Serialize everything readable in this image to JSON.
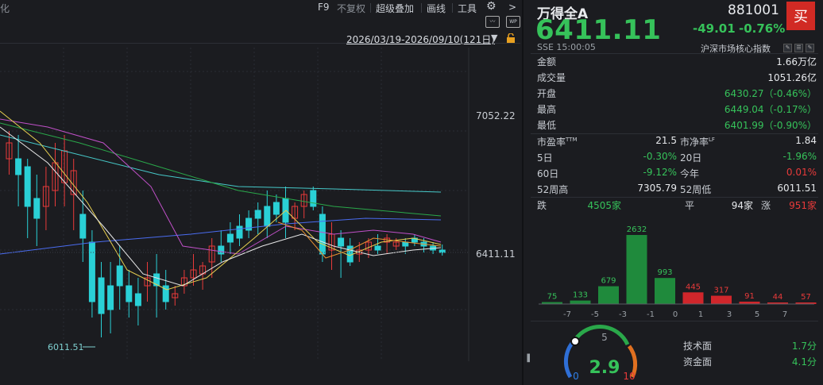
{
  "toolbar": {
    "items": [
      "F9",
      "不复权",
      "超级叠加",
      "画线",
      "工具"
    ],
    "left_cut": "化",
    "chevron": ">"
  },
  "range_label": "2026/03/19-2026/09/10(121日)",
  "chart_labels": {
    "y_top": "7052.22",
    "y_current": "6411.11",
    "low_mark": "6011.51"
  },
  "header": {
    "name": "万得全A",
    "code": "881001",
    "buy_label": "买",
    "price": "6411.11",
    "change": "-49.01",
    "change_pct": "-0.76%",
    "exchange_time": "SSE  15:00:05",
    "index_group": "沪深市场核心指数"
  },
  "stats": {
    "amount_label": "金额",
    "amount": "1.66万亿",
    "volume_label": "成交量",
    "volume": "1051.26亿",
    "open_label": "开盘",
    "open": "6430.27（-0.46%）",
    "high_label": "最高",
    "high": "6449.04（-0.17%）",
    "low_label": "最低",
    "low": "6401.99（-0.90%）"
  },
  "metrics": {
    "pe_label": "市盈率",
    "pe_sup": "TTM",
    "pe": "21.5",
    "pb_label": "市净率",
    "pb_sup": "LF",
    "pb": "1.84",
    "d5_label": "5日",
    "d5": "-0.30%",
    "d20_label": "20日",
    "d20": "-1.96%",
    "d60_label": "60日",
    "d60": "-9.12%",
    "ytd_label": "今年",
    "ytd": "0.01%",
    "w52h_label": "52周高",
    "w52h": "7305.79",
    "w52l_label": "52周低",
    "w52l": "6011.51"
  },
  "breadth": {
    "down_label": "跌",
    "down": "4505家",
    "flat_label": "平",
    "flat": "94家",
    "up_label": "涨",
    "up": "951家"
  },
  "chart_data": {
    "type": "bar",
    "categories": [
      "-7",
      "-5",
      "-3",
      "-1",
      "0",
      "1",
      "3",
      "5",
      "7"
    ],
    "values": [
      75,
      133,
      679,
      2632,
      993,
      445,
      317,
      91,
      44,
      57
    ],
    "bar_positions": [
      "<-7",
      "-7~-5",
      "-5~-3",
      "-3~-1",
      "-1~0",
      "0~1",
      "1~3",
      "3~5",
      "5~7",
      ">7"
    ],
    "colors_down": "#1f8a3c",
    "colors_up": "#d0262b"
  },
  "score": {
    "value": "2.9",
    "min": "0",
    "mid": "5",
    "max": "10",
    "level": 2.9,
    "tech_label": "技术面",
    "tech": "1.7分",
    "fund_label": "资金面",
    "fund": "4.1分"
  },
  "colors": {
    "green": "#36c25a",
    "red": "#e83a3a",
    "bg": "#1b1c20"
  }
}
